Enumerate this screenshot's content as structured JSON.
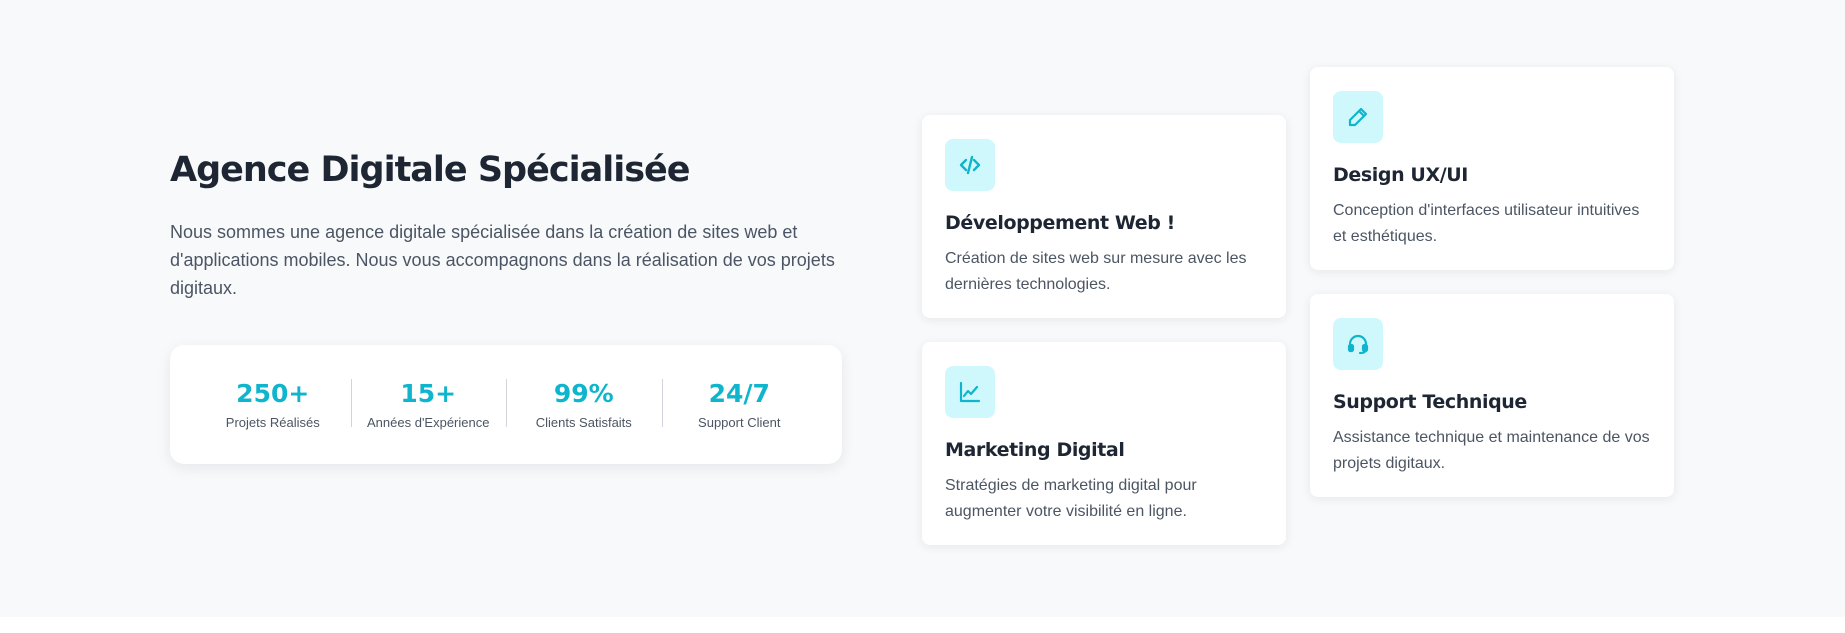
{
  "intro": {
    "title": "Agence Digitale Spécialisée",
    "description": "Nous sommes une agence digitale spécialisée dans la création de sites web et d'applications mobiles. Nous vous accompagnons dans la réalisation de vos projets digitaux."
  },
  "stats": [
    {
      "value": "250+",
      "label": "Projets Réalisés"
    },
    {
      "value": "15+",
      "label": "Années d'Expérience"
    },
    {
      "value": "99%",
      "label": "Clients Satisfaits"
    },
    {
      "value": "24/7",
      "label": "Support Client"
    }
  ],
  "services": {
    "web": {
      "icon": "code-icon",
      "title": "Développement Web !",
      "description": "Création de sites web sur mesure avec les dernières technologies."
    },
    "marketing": {
      "icon": "chart-line-icon",
      "title": "Marketing Digital",
      "description": "Stratégies de marketing digital pour augmenter votre visibilité en ligne."
    },
    "design": {
      "icon": "pencil-icon",
      "title": "Design UX/UI",
      "description": "Conception d'interfaces utilisateur intuitives et esthétiques."
    },
    "support": {
      "icon": "headset-icon",
      "title": "Support Technique",
      "description": "Assistance technique et maintenance de vos projets digitaux."
    }
  },
  "colors": {
    "accent": "#0fb5cc",
    "icon_background": "#cff8fd",
    "section_background": "#f8f9fb",
    "heading": "#1e2533",
    "body_text": "#4b5563"
  }
}
